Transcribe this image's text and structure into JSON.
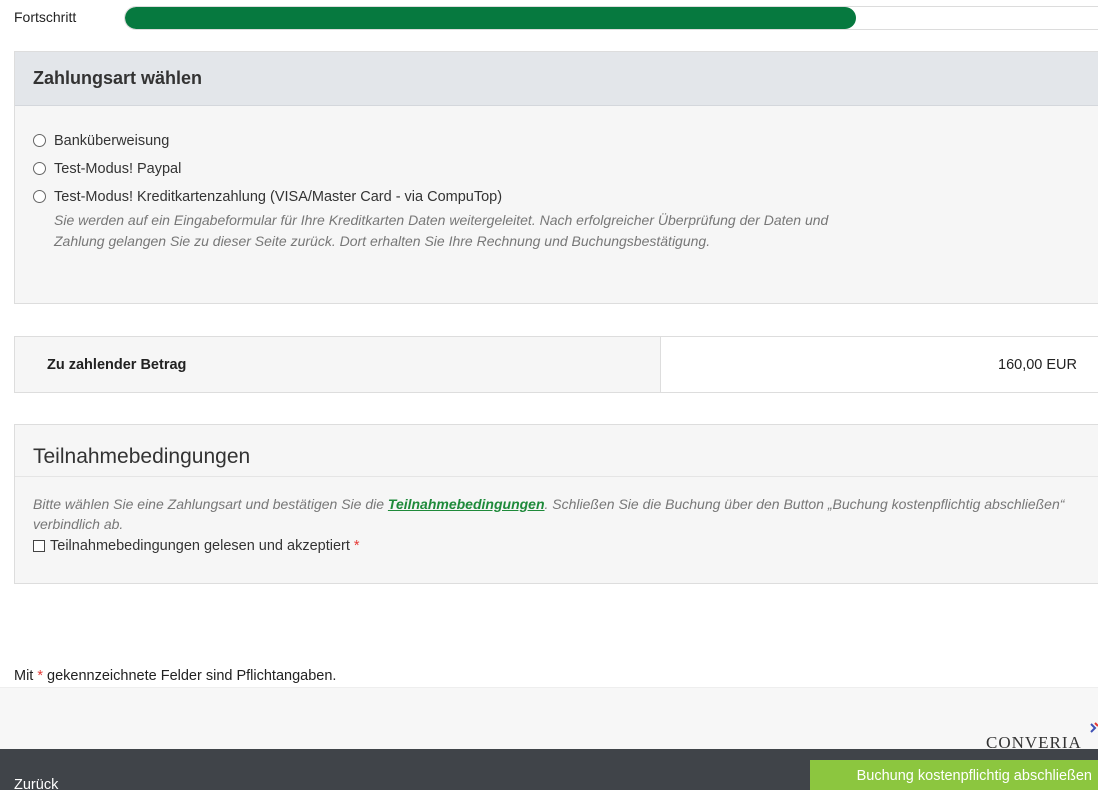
{
  "progress": {
    "label": "Fortschritt",
    "value_percent": 74,
    "color": "#06793f"
  },
  "payment": {
    "title": "Zahlungsart wählen",
    "options": [
      {
        "label": "Banküberweisung",
        "selected": false
      },
      {
        "label": "Test-Modus! Paypal",
        "selected": false
      },
      {
        "label": "Test-Modus! Kreditkartenzahlung (VISA/Master Card - via CompuTop)",
        "selected": false
      }
    ],
    "cc_note": "Sie werden auf ein Eingabeformular für Ihre Kreditkarten Daten weitergeleitet. Nach erfolgreicher Überprüfung der Daten und Zahlung gelangen Sie zu dieser Seite zurück. Dort erhalten Sie Ihre Rechnung und Buchungsbestätigung."
  },
  "amount": {
    "label": "Zu zahlender Betrag",
    "value": "160,00 EUR"
  },
  "terms": {
    "title": "Teilnahmebedingungen",
    "text_before": "Bitte wählen Sie eine Zahlungsart und bestätigen Sie die ",
    "link_text": "Teilnahmebedingungen",
    "text_after": ". Schließen Sie die Buchung über den Button „Buchung kostenpflichtig abschließen“ verbindlich ab.",
    "checkbox_label": "Teilnahmebedingungen gelesen und akzeptiert",
    "required_mark": "*"
  },
  "required_note": {
    "before": "Mit ",
    "mark": "*",
    "after": " gekennzeichnete Felder sind Pflichtangaben."
  },
  "logo_text": "CONVERIA",
  "footer": {
    "back_label": "Zurück",
    "submit_label": "Buchung kostenpflichtig abschließen",
    "submit_color": "#8cc63f"
  }
}
